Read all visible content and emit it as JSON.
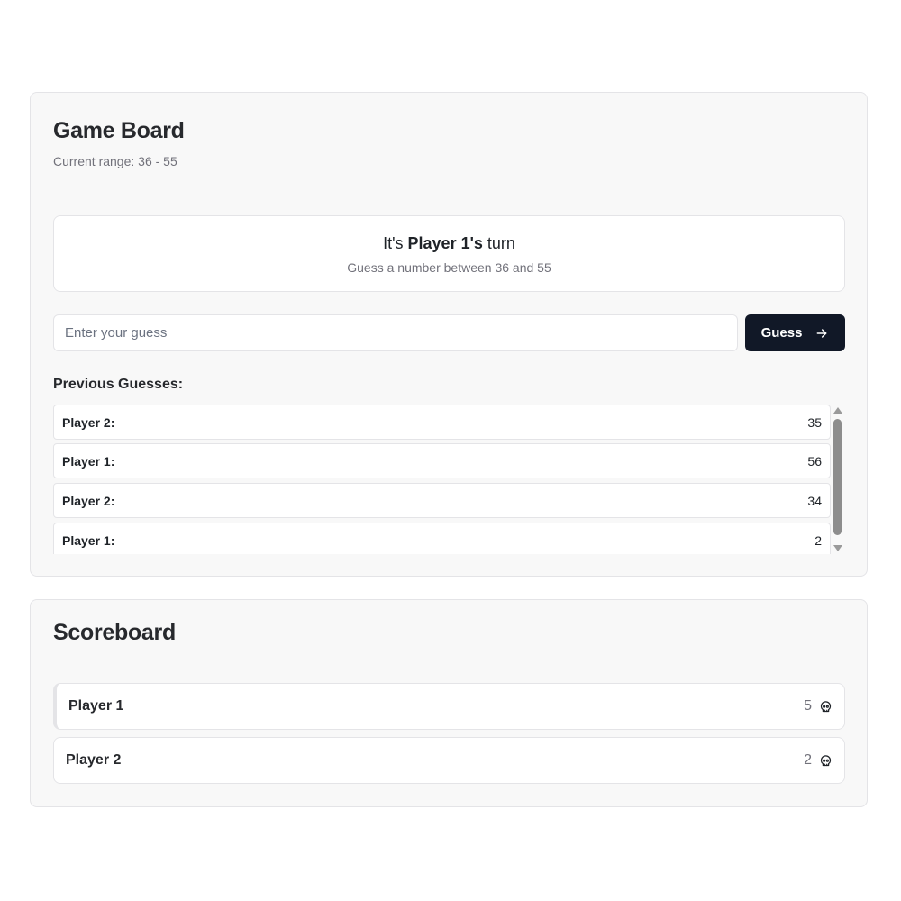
{
  "game_board": {
    "title": "Game Board",
    "range_text": "Current range: 36 - 55",
    "turn": {
      "prefix": "It's ",
      "player": "Player 1's",
      "suffix": " turn",
      "subtitle": "Guess a number between 36 and 55"
    },
    "input": {
      "placeholder": "Enter your guess",
      "value": ""
    },
    "guess_button": {
      "label": "Guess",
      "icon": "arrow-right-icon"
    },
    "previous_title": "Previous Guesses:",
    "previous_guesses": [
      {
        "player": "Player 2:",
        "value": "35"
      },
      {
        "player": "Player 1:",
        "value": "56"
      },
      {
        "player": "Player 2:",
        "value": "34"
      },
      {
        "player": "Player 1:",
        "value": "2"
      }
    ]
  },
  "scoreboard": {
    "title": "Scoreboard",
    "players": [
      {
        "name": "Player 1",
        "score": "5",
        "icon": "skull-icon",
        "active": true
      },
      {
        "name": "Player 2",
        "score": "2",
        "icon": "skull-icon",
        "active": false
      }
    ]
  },
  "colors": {
    "button_bg": "#111827",
    "card_bg": "#f8f8f8",
    "border": "#e4e4e7",
    "muted_text": "#71717a"
  }
}
